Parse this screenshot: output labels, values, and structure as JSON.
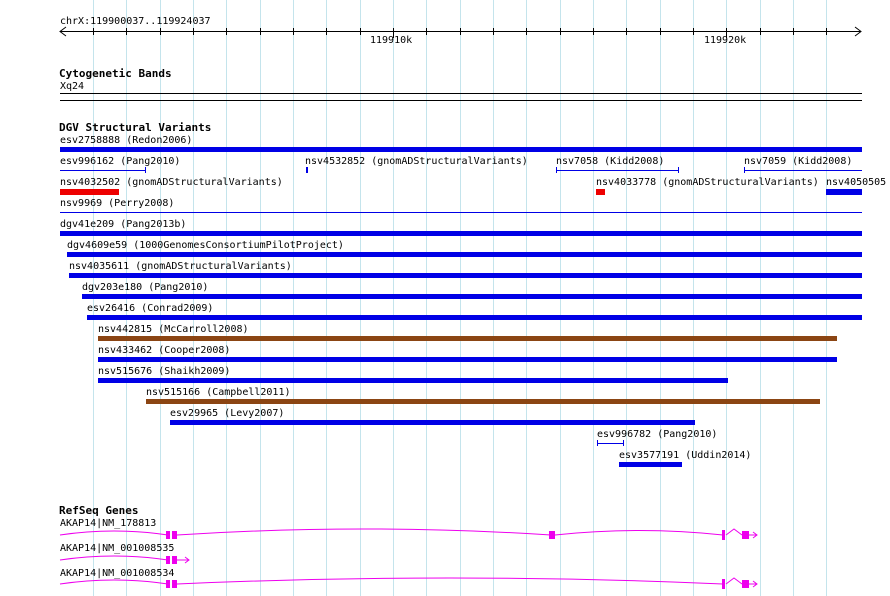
{
  "browser": {
    "location": "chrX:119900037..119924037",
    "ruler": {
      "labels": [
        "119910k",
        "119920k"
      ]
    }
  },
  "tracks": {
    "cytoband": {
      "title": "Cytogenetic Bands",
      "band_label": "Xq24"
    },
    "dgv": {
      "title": "DGV Structural Variants",
      "features": [
        {
          "label": "esv2758888 (Redon2006)"
        },
        {
          "label": "esv996162 (Pang2010)"
        },
        {
          "label": "nsv4532852 (gnomADStructuralVariants)"
        },
        {
          "label": "nsv7058 (Kidd2008)"
        },
        {
          "label": "nsv7059 (Kidd2008)"
        },
        {
          "label": "nsv4032502 (gnomADStructuralVariants)"
        },
        {
          "label": "nsv4033778 (gnomADStructuralVariants)"
        },
        {
          "label": "nsv4050505"
        },
        {
          "label": "nsv9969 (Perry2008)"
        },
        {
          "label": "dgv41e209 (Pang2013b)"
        },
        {
          "label": "dgv4609e59 (1000GenomesConsortiumPilotProject)"
        },
        {
          "label": "nsv4035611 (gnomADStructuralVariants)"
        },
        {
          "label": "dgv203e180 (Pang2010)"
        },
        {
          "label": "esv26416 (Conrad2009)"
        },
        {
          "label": "nsv442815 (McCarroll2008)"
        },
        {
          "label": "nsv433462 (Cooper2008)"
        },
        {
          "label": "nsv515676 (Shaikh2009)"
        },
        {
          "label": "nsv515166 (Campbell2011)"
        },
        {
          "label": "esv29965 (Levy2007)"
        },
        {
          "label": "esv996782 (Pang2010)"
        },
        {
          "label": "esv3577191 (Uddin2014)"
        }
      ]
    },
    "refseq": {
      "title": "RefSeq Genes",
      "transcripts": [
        {
          "label": "AKAP14|NM_178813"
        },
        {
          "label": "AKAP14|NM_001008535"
        },
        {
          "label": "AKAP14|NM_001008534"
        }
      ]
    }
  },
  "colors": {
    "grid": "#c4e4ec",
    "blue": "#0000e6",
    "red": "#ee0000",
    "brown": "#8b4513",
    "gene": "#ee00ee"
  }
}
